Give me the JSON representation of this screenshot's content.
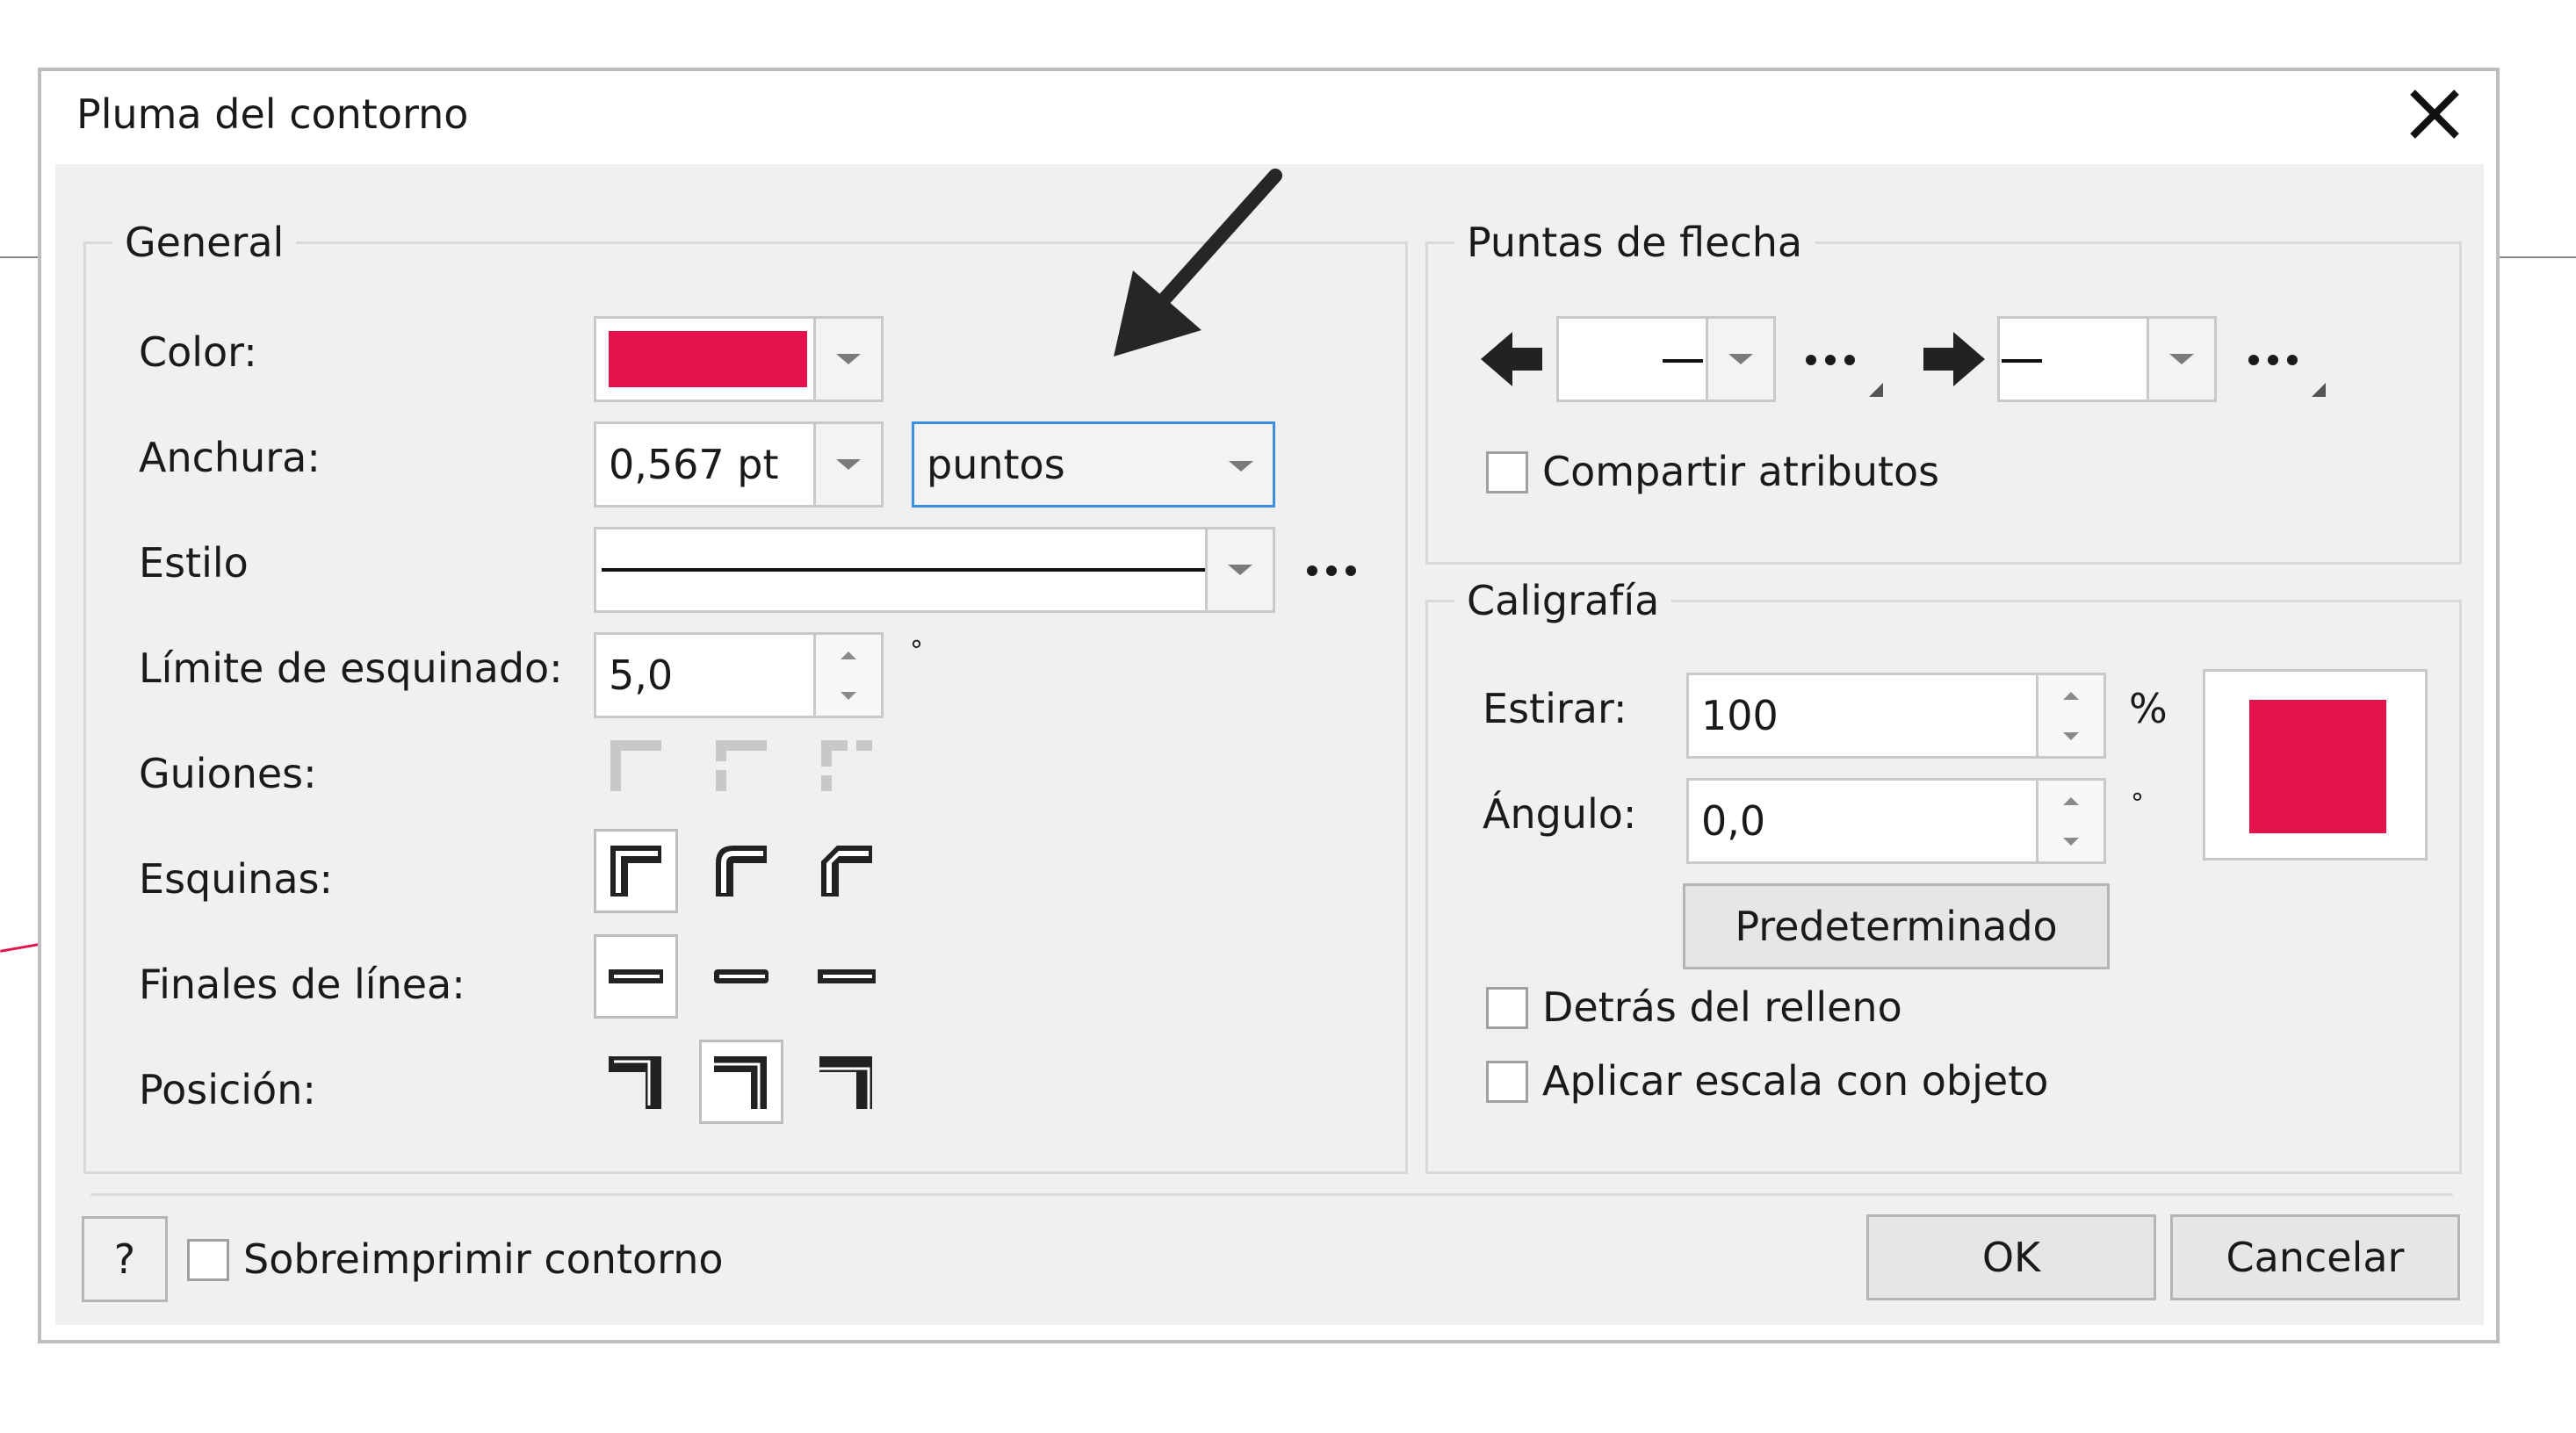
{
  "dialog": {
    "title": "Pluma del contorno",
    "close_glyph": "✕"
  },
  "general": {
    "legend": "General",
    "color_label": "Color:",
    "color_value": "#e3124a",
    "width_label": "Anchura:",
    "width_value": "0,567 pt",
    "units_value": "puntos",
    "style_label": "Estilo",
    "miter_label": "Límite de esquinado:",
    "miter_value": "5,0",
    "miter_unit": "°",
    "dashes_label": "Guiones:",
    "corners_label": "Esquinas:",
    "line_caps_label": "Finales de línea:",
    "position_label": "Posición:"
  },
  "arrowheads": {
    "legend": "Puntas de flecha",
    "share_label": "Compartir atributos"
  },
  "calligraphy": {
    "legend": "Caligrafía",
    "stretch_label": "Estirar:",
    "stretch_value": "100",
    "stretch_unit": "%",
    "angle_label": "Ángulo:",
    "angle_value": "0,0",
    "angle_unit": "°",
    "default_button": "Predeterminado",
    "nib_color": "#e3124a",
    "behind_fill_label": "Detrás del relleno",
    "scale_label": "Aplicar escala con objeto"
  },
  "footer": {
    "help_label": "?",
    "overprint_label": "Sobreimprimir contorno",
    "ok_label": "OK",
    "cancel_label": "Cancelar"
  },
  "icons": {
    "more": "ellipsis-icon",
    "annotation": "annotation-arrow-icon"
  }
}
